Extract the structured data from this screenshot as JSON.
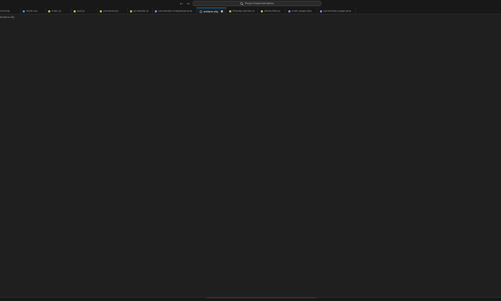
{
  "command_center": {
    "label": "Plugin Experimentation"
  },
  "tabs": [
    {
      "label": "ndi.php",
      "icon_color": "#6b79b8",
      "active": false,
      "dirty": false
    },
    {
      "label": "style.css",
      "icon_color": "#4a9fd6",
      "active": false,
      "dirty": false
    },
    {
      "label": "main.js",
      "icon_color": "#cbcb41",
      "active": false,
      "dirty": false
    },
    {
      "label": "poll.js",
      "icon_color": "#cbcb41",
      "active": false,
      "dirty": false
    },
    {
      "label": "convertor.js",
      "icon_color": "#cbcb41",
      "active": false,
      "dirty": false
    },
    {
      "label": "pf-worker.js",
      "icon_color": "#cbcb41",
      "active": false,
      "dirty": false
    },
    {
      "label": "conversion-mappings.php",
      "icon_color": "#8a8fe0",
      "active": false,
      "dirty": false
    },
    {
      "label": "actions.cfg",
      "icon_color": "#8a8a8a",
      "active": true,
      "dirty": true
    },
    {
      "label": "ffmpeg-worker.js",
      "icon_color": "#cbcb41",
      "active": false,
      "dirty": false
    },
    {
      "label": "allow-files.js",
      "icon_color": "#cbcb41",
      "active": false,
      "dirty": false
    },
    {
      "label": "main-page.php",
      "icon_color": "#8a8fe0",
      "active": false,
      "dirty": false
    },
    {
      "label": "conversion-page.php",
      "icon_color": "#8a8fe0",
      "active": false,
      "dirty": false
    }
  ],
  "breadcrumb": {
    "file": "actions.cfg"
  },
  "colors": {
    "editor_bg": "#1f1f1f",
    "chrome_bg": "#181818",
    "accent": "#0078d4"
  }
}
